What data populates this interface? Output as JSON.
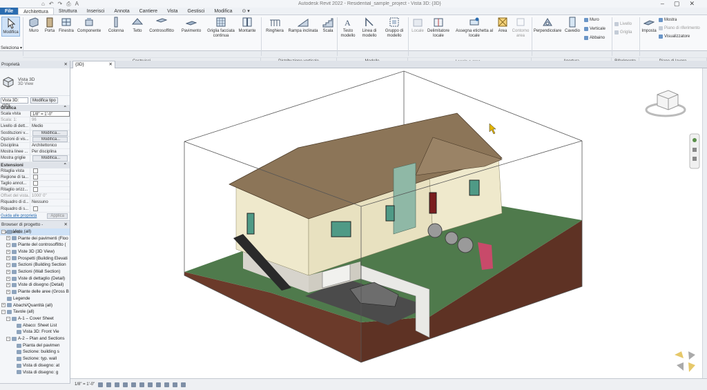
{
  "window": {
    "title": "Autodesk Revit 2022 - Residential_sample_project - Vista 3D: {3D}",
    "quick_access": [
      "⌂",
      "↶",
      "↷",
      "⎙",
      "A"
    ],
    "controls": [
      "–",
      "▢",
      "✕"
    ]
  },
  "tabs": [
    "File",
    "Architettura",
    "Struttura",
    "Inserisci",
    "Annota",
    "Cantiere",
    "Vista",
    "Gestisci",
    "Modifica",
    "⊙ ▾"
  ],
  "active_tab": "Architettura",
  "ribbon": {
    "modify": {
      "label": "Modifica",
      "sub": "Seleziona ▾"
    },
    "build": [
      "Muro",
      "Porta",
      "Finestra",
      "Componente",
      "Colonna",
      "Tetto",
      "Controsoffitto",
      "Pavimento",
      "Griglia facciata continua",
      "Montante"
    ],
    "circulation": [
      "Ringhiera",
      "Rampa inclinata",
      "Scala"
    ],
    "model": [
      "Testo modello",
      "Linea di modello",
      "Gruppo di modello"
    ],
    "room": [
      "Locale",
      "Delimitatore locale",
      "Assegna etichetta al locale",
      "Area",
      "Contorno area"
    ],
    "opening": [
      "Perpendicolare",
      "Cavedio"
    ],
    "opening_small": [
      "Muro",
      "Verticale",
      "Abbaino"
    ],
    "datum_small": [
      "Livello",
      "Griglia"
    ],
    "workplane": [
      "Imposta"
    ],
    "workplane_small": [
      "Mostra",
      "Piano di riferimento",
      "Visualizzatore"
    ],
    "panels": [
      "Costruisci",
      "Distribuzione verticale",
      "Modello",
      "Locale e area ▾",
      "Apertura",
      "Riferimento",
      "Piano di lavoro"
    ]
  },
  "properties": {
    "panel_title": "Proprietà",
    "element_type": "Vista 3D",
    "element_subtype": "3D View",
    "type_selector": "Vista 3D: {3D}",
    "edit_type": "Modifica tipo",
    "groups": [
      {
        "name": "Grafica",
        "rows": [
          {
            "key": "Scala vista",
            "value": "1/8\" = 1'-0\""
          },
          {
            "key": "Scala: 1:",
            "value": "96",
            "muted": true
          },
          {
            "key": "Livello di dett...",
            "value": "Medio"
          },
          {
            "key": "Sostituzioni v...",
            "value": "Modifica...",
            "button": true
          },
          {
            "key": "Opzioni di vis...",
            "value": "Modifica...",
            "button": true
          },
          {
            "key": "Disciplina",
            "value": "Architettonico"
          },
          {
            "key": "Mostra linee ...",
            "value": "Per disciplina"
          },
          {
            "key": "Mostra griglie",
            "value": "Modifica...",
            "button": true
          }
        ]
      },
      {
        "name": "Estensioni",
        "rows": [
          {
            "key": "Ritaglia vista",
            "check": true
          },
          {
            "key": "Regione di ta...",
            "check": true
          },
          {
            "key": "Taglio annot...",
            "check": true
          },
          {
            "key": "Ritaglio orizz...",
            "check": true
          },
          {
            "key": "Offset del vista...",
            "value": "1000' 0\"",
            "muted": true
          },
          {
            "key": "Riquadro di d...",
            "value": "Nessuno"
          },
          {
            "key": "Riquadro di s...",
            "check": true
          }
        ]
      }
    ],
    "help_link": "Guida alle proprietà",
    "apply": "Applica"
  },
  "browser": {
    "title": "Browser di progetto - Residenti...",
    "nodes": [
      {
        "label": "Viste (all)",
        "depth": 0,
        "expander": "–",
        "selected": true
      },
      {
        "label": "Piante dei pavimenti (Floo",
        "depth": 1,
        "expander": "+"
      },
      {
        "label": "Piante del controsoffitto (",
        "depth": 1,
        "expander": "+"
      },
      {
        "label": "Viste 3D (3D View)",
        "depth": 1,
        "expander": "+"
      },
      {
        "label": "Prospetti (Building Elevati",
        "depth": 1,
        "expander": "+"
      },
      {
        "label": "Sezioni (Building Section",
        "depth": 1,
        "expander": "+"
      },
      {
        "label": "Sezioni (Wall Section)",
        "depth": 1,
        "expander": "+"
      },
      {
        "label": "Viste di dettaglio (Detail)",
        "depth": 1,
        "expander": "+"
      },
      {
        "label": "Viste di disegno (Detail)",
        "depth": 1,
        "expander": "+"
      },
      {
        "label": "Piante delle aree (Gross B",
        "depth": 1,
        "expander": "+"
      },
      {
        "label": "Legende",
        "depth": 0,
        "expander": ""
      },
      {
        "label": "Abachi/Quantità (all)",
        "depth": 0,
        "expander": "+"
      },
      {
        "label": "Tavole (all)",
        "depth": 0,
        "expander": "–"
      },
      {
        "label": "A-1 – Cover Sheet",
        "depth": 1,
        "expander": "–"
      },
      {
        "label": "Abaco: Sheet List",
        "depth": 2,
        "expander": ""
      },
      {
        "label": "Vista 3D: Front Vie",
        "depth": 2,
        "expander": ""
      },
      {
        "label": "A-2 – Plan and Sections",
        "depth": 1,
        "expander": "–"
      },
      {
        "label": "Pianta del pavimen",
        "depth": 2,
        "expander": ""
      },
      {
        "label": "Sezione: building s",
        "depth": 2,
        "expander": ""
      },
      {
        "label": "Sezione: typ. wall",
        "depth": 2,
        "expander": ""
      },
      {
        "label": "Vista di disegno: at",
        "depth": 2,
        "expander": ""
      },
      {
        "label": "Vista di disegno: g",
        "depth": 2,
        "expander": ""
      }
    ]
  },
  "view_tab": {
    "label": "{3D}",
    "close": "✕"
  },
  "status": {
    "scale": "1/8\" = 1'-0\""
  },
  "colors": {
    "roof": "#8c7558",
    "siding": "#efe9cc",
    "chimney": "#8fb8a6",
    "grass": "#4f7a4c",
    "soil": "#6b3a2a",
    "accent": "#2b6cb0"
  }
}
